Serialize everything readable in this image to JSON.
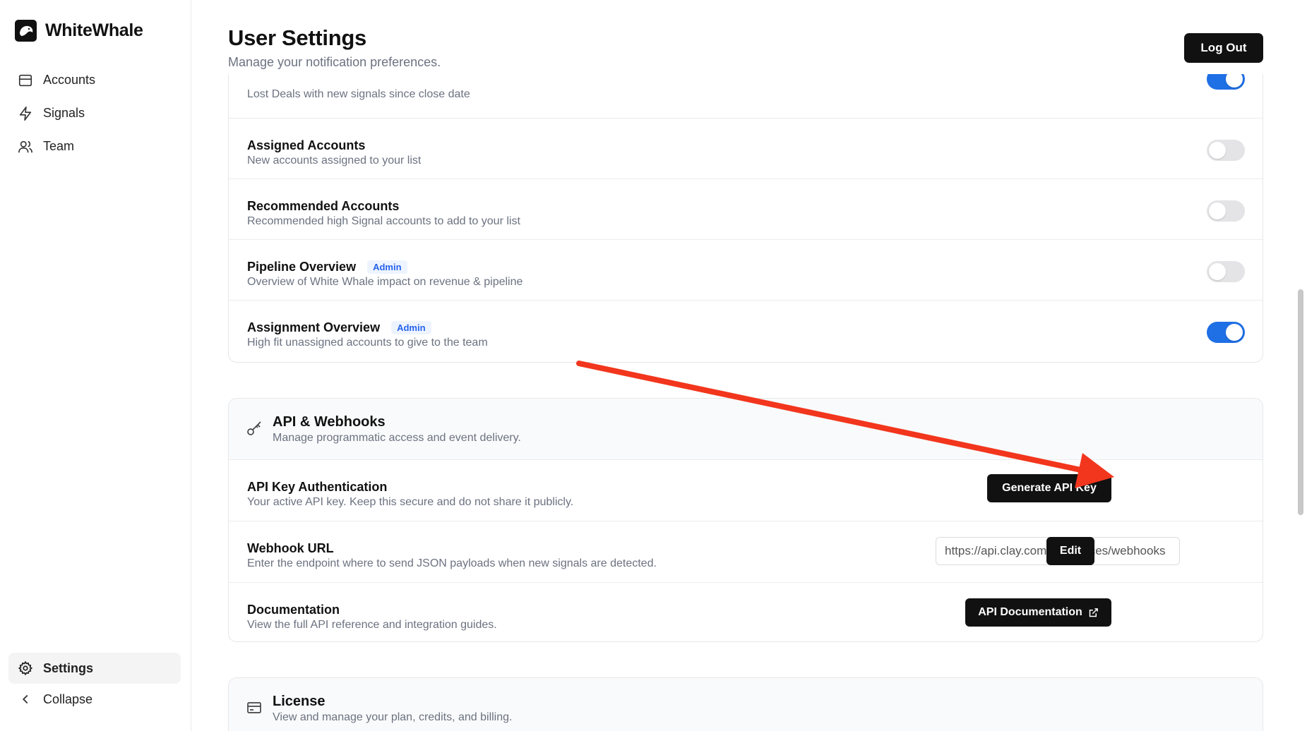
{
  "brand": {
    "name": "WhiteWhale"
  },
  "sidebar": {
    "items": [
      {
        "label": "Accounts",
        "icon": "accounts-icon"
      },
      {
        "label": "Signals",
        "icon": "lightning-icon"
      },
      {
        "label": "Team",
        "icon": "team-icon"
      }
    ],
    "bottom": [
      {
        "label": "Settings",
        "icon": "gear-icon",
        "active": true
      },
      {
        "label": "Collapse",
        "icon": "chevron-left-icon"
      }
    ]
  },
  "header": {
    "title": "User Settings",
    "subtitle": "Manage your notification preferences.",
    "logout_label": "Log Out"
  },
  "notifications": [
    {
      "title": "",
      "desc": "Lost Deals with new signals since close date",
      "enabled": true
    },
    {
      "title": "Assigned Accounts",
      "desc": "New accounts assigned to your list",
      "enabled": false
    },
    {
      "title": "Recommended Accounts",
      "desc": "Recommended high Signal accounts to add to your list",
      "enabled": false
    },
    {
      "title": "Pipeline Overview",
      "badge": "Admin",
      "desc": "Overview of White Whale impact on revenue & pipeline",
      "enabled": false
    },
    {
      "title": "Assignment Overview",
      "badge": "Admin",
      "desc": "High fit unassigned accounts to give to the team",
      "enabled": true
    }
  ],
  "api": {
    "title": "API & Webhooks",
    "subtitle": "Manage programmatic access and event delivery.",
    "key_title": "API Key Authentication",
    "key_desc": "Your active API key. Keep this secure and do not share it publicly.",
    "generate_label": "Generate API Key",
    "webhook_title": "Webhook URL",
    "webhook_desc": "Enter the endpoint where to send JSON payloads when new signals are detected.",
    "webhook_value": "https://api.clay.com/v3/sources/webhooks",
    "edit_label": "Edit",
    "doc_title": "Documentation",
    "doc_desc": "View the full API reference and integration guides.",
    "doc_button_label": "API Documentation"
  },
  "license": {
    "title": "License",
    "subtitle": "View and manage your plan, credits, and billing."
  },
  "colors": {
    "accent": "#1f6fe5",
    "annotation_arrow": "#f2361d"
  }
}
